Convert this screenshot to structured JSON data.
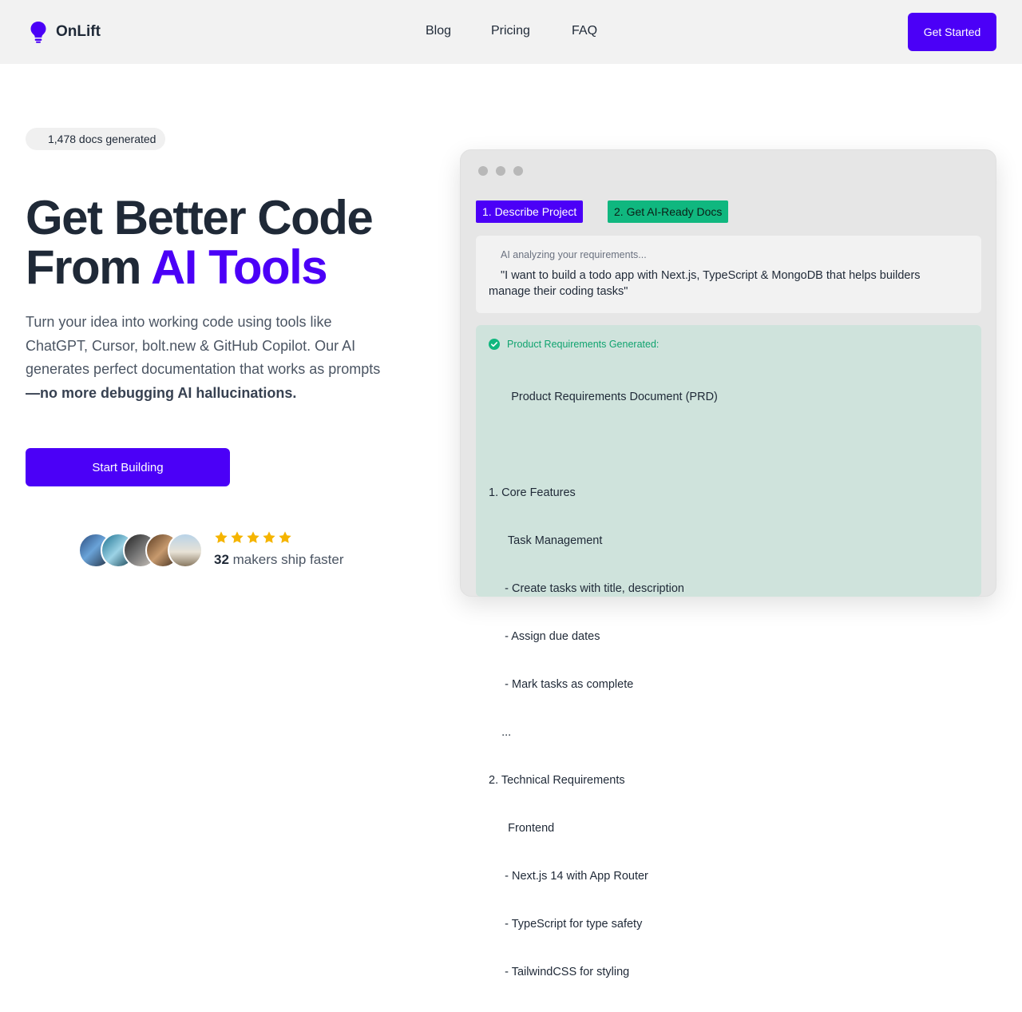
{
  "header": {
    "logo_text": "OnLift",
    "nav": [
      "Blog",
      "Pricing",
      "FAQ"
    ],
    "cta": "Get Started"
  },
  "hero": {
    "badge": "1,478 docs generated",
    "title_line1": "Get Better Code",
    "title_line2_prefix": "From ",
    "title_line2_accent": "AI Tools",
    "description": "Turn your idea into working code using tools like ChatGPT, Cursor, bolt.new & GitHub Copilot. Our AI generates perfect documentation that works as prompts ",
    "description_strong": "—no more debugging AI hallucinations.",
    "cta": "Start Building",
    "rating_stars": 5,
    "makers_count": "32",
    "makers_text": " makers ship faster"
  },
  "demo": {
    "step1": "1. Describe Project",
    "step2": "2. Get AI-Ready Docs",
    "analyzing": "AI analyzing your requirements...",
    "prompt": "\"I want to build a todo app with Next.js, TypeScript & MongoDB that helps builders manage their coding tasks\"",
    "prd_status": "Product Requirements Generated:",
    "prd_lines": [
      "       Product Requirements Document (PRD)",
      "",
      "1. Core Features",
      "      Task Management",
      "     - Create tasks with title, description",
      "     - Assign due dates",
      "     - Mark tasks as complete",
      "    ...",
      "2. Technical Requirements",
      "      Frontend",
      "     - Next.js 14 with App Router",
      "     - TypeScript for type safety",
      "     - TailwindCSS for styling"
    ]
  },
  "colors": {
    "brand": "#4b00f7",
    "success": "#10b77f",
    "star": "#f5b400"
  }
}
